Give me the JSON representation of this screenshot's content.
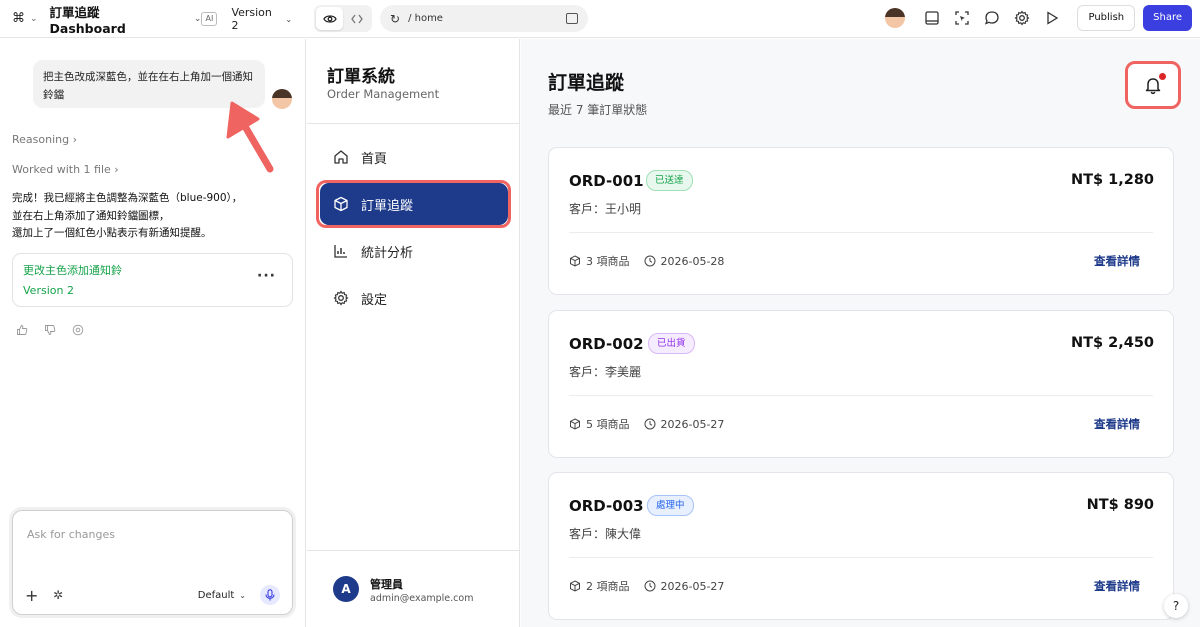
{
  "topbar": {
    "project_title": "訂單追蹤 Dashboard",
    "ai_badge": "AI",
    "version": "Version 2",
    "url": "/ home",
    "publish": "Publish",
    "share": "Share"
  },
  "chat": {
    "user_message": "把主色改成深藍色，並在在右上角加一個通知鈴鐺",
    "reasoning": "Reasoning",
    "worked": "Worked with 1 file",
    "reply_lines": [
      "完成！我已經將主色調整為深藍色（blue-900），",
      "並在右上角添加了通知鈴鐺圖標，",
      "還加上了一個紅色小點表示有新通知提醒。"
    ],
    "version_card": {
      "title": "更改主色添加通知鈴",
      "version": "Version 2"
    },
    "composer": {
      "placeholder": "Ask for changes",
      "model": "Default"
    }
  },
  "sidebar": {
    "title": "訂單系統",
    "subtitle": "Order Management",
    "items": [
      {
        "label": "首頁",
        "icon": "home-icon",
        "active": false
      },
      {
        "label": "訂單追蹤",
        "icon": "package-icon",
        "active": true
      },
      {
        "label": "統計分析",
        "icon": "chart-icon",
        "active": false
      },
      {
        "label": "設定",
        "icon": "gear-icon",
        "active": false
      }
    ],
    "user": {
      "initial": "A",
      "name": "管理員",
      "email": "admin@example.com"
    }
  },
  "main": {
    "title": "訂單追蹤",
    "subtitle": "最近 7 筆訂單狀態",
    "orders": [
      {
        "id": "ORD-001",
        "status": "已送達",
        "status_color": "#16a34a",
        "amount": "NT$ 1,280",
        "customer": "客戶：王小明",
        "items": "3 項商品",
        "date": "2026-05-28",
        "detail": "查看詳情"
      },
      {
        "id": "ORD-002",
        "status": "已出貨",
        "status_color": "#9333ea",
        "amount": "NT$ 2,450",
        "customer": "客戶：李美麗",
        "items": "5 項商品",
        "date": "2026-05-27",
        "detail": "查看詳情"
      },
      {
        "id": "ORD-003",
        "status": "處理中",
        "status_color": "#2563eb",
        "amount": "NT$ 890",
        "customer": "客戶：陳大偉",
        "items": "2 項商品",
        "date": "2026-05-27",
        "detail": "查看詳情"
      }
    ]
  },
  "help": "?",
  "colors": {
    "primary": "#1e3a8a",
    "accent": "#3b3fe0",
    "annotation": "#ef6461",
    "notify": "#dc2626"
  }
}
